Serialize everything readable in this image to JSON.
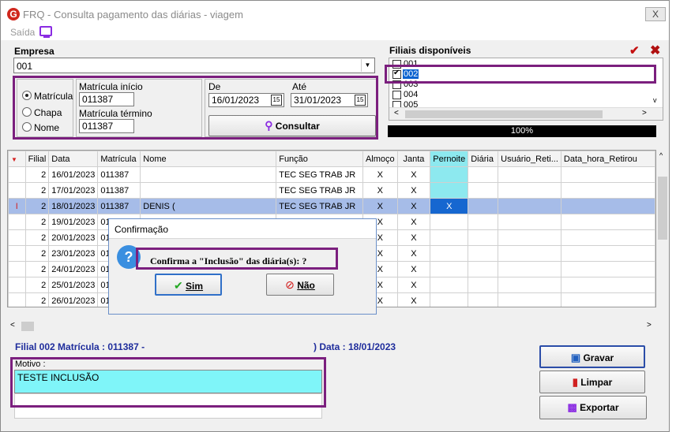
{
  "window": {
    "title": "FRQ - Consulta pagamento das diárias - viagem",
    "close": "X"
  },
  "menu": {
    "saida": "Saída"
  },
  "empresa": {
    "label": "Empresa",
    "value": "001"
  },
  "filter": {
    "radio_matricula": "Matrícula",
    "radio_chapa": "Chapa",
    "radio_nome": "Nome",
    "selected": "Matrícula",
    "mat_inicio_label": "Matrícula início",
    "mat_inicio_value": "011387",
    "mat_termino_label": "Matrícula término",
    "mat_termino_value": "011387",
    "de_label": "De",
    "de_value": "16/01/2023",
    "ate_label": "Até",
    "ate_value": "31/01/2023",
    "consultar_label": "Consultar"
  },
  "filiais": {
    "label": "Filiais disponíveis",
    "items": [
      {
        "code": "001",
        "checked": false
      },
      {
        "code": "002",
        "checked": true
      },
      {
        "code": "003",
        "checked": false
      },
      {
        "code": "004",
        "checked": false
      },
      {
        "code": "005",
        "checked": false
      }
    ],
    "progress": "100%"
  },
  "grid": {
    "columns": [
      "Filial",
      "Data",
      "Matrícula",
      "Nome",
      "Função",
      "Almoço",
      "Janta",
      "Pernoite",
      "Diária",
      "Usuário_Reti...",
      "Data_hora_Retirou"
    ],
    "rows": [
      {
        "filial": "2",
        "data": "16/01/2023",
        "mat": "011387",
        "nome": "",
        "funcao": "TEC SEG TRAB JR",
        "almoco": "X",
        "janta": "X",
        "pernoite": ""
      },
      {
        "filial": "2",
        "data": "17/01/2023",
        "mat": "011387",
        "nome": "",
        "funcao": "TEC SEG TRAB JR",
        "almoco": "X",
        "janta": "X",
        "pernoite": ""
      },
      {
        "filial": "2",
        "data": "18/01/2023",
        "mat": "011387",
        "nome": "DENIS (",
        "funcao": "TEC SEG TRAB JR",
        "almoco": "X",
        "janta": "X",
        "pernoite": "X"
      },
      {
        "filial": "2",
        "data": "19/01/2023",
        "mat": "01",
        "nome": "",
        "funcao": "",
        "almoco": "X",
        "janta": "X",
        "pernoite": ""
      },
      {
        "filial": "2",
        "data": "20/01/2023",
        "mat": "01",
        "nome": "",
        "funcao": "",
        "almoco": "X",
        "janta": "X",
        "pernoite": ""
      },
      {
        "filial": "2",
        "data": "23/01/2023",
        "mat": "01",
        "nome": "",
        "funcao": "",
        "almoco": "X",
        "janta": "X",
        "pernoite": ""
      },
      {
        "filial": "2",
        "data": "24/01/2023",
        "mat": "01",
        "nome": "",
        "funcao": "",
        "almoco": "X",
        "janta": "X",
        "pernoite": ""
      },
      {
        "filial": "2",
        "data": "25/01/2023",
        "mat": "01",
        "nome": "",
        "funcao": "",
        "almoco": "X",
        "janta": "X",
        "pernoite": ""
      },
      {
        "filial": "2",
        "data": "26/01/2023",
        "mat": "01",
        "nome": "",
        "funcao": "",
        "almoco": "X",
        "janta": "X",
        "pernoite": ""
      }
    ]
  },
  "status": {
    "left": "Filial 002  Matrícula : 011387 -",
    "right": ")  Data : 18/01/2023"
  },
  "motivo": {
    "label": "Motivo :",
    "value": "TESTE INCLUSÃO"
  },
  "buttons": {
    "gravar": "Gravar",
    "limpar": "Limpar",
    "exportar": "Exportar"
  },
  "dialog": {
    "title": "Confirmação",
    "message": "Confirma a \"Inclusão\" das diária(s): ?",
    "sim": "Sim",
    "nao": "Não"
  },
  "colors": {
    "highlight": "#7b1f7e",
    "selected_row": "#a6bce8",
    "pernoite": "#8de9ef",
    "motivo_bg": "#7ff5f9",
    "status_text": "#1f2d9c"
  }
}
